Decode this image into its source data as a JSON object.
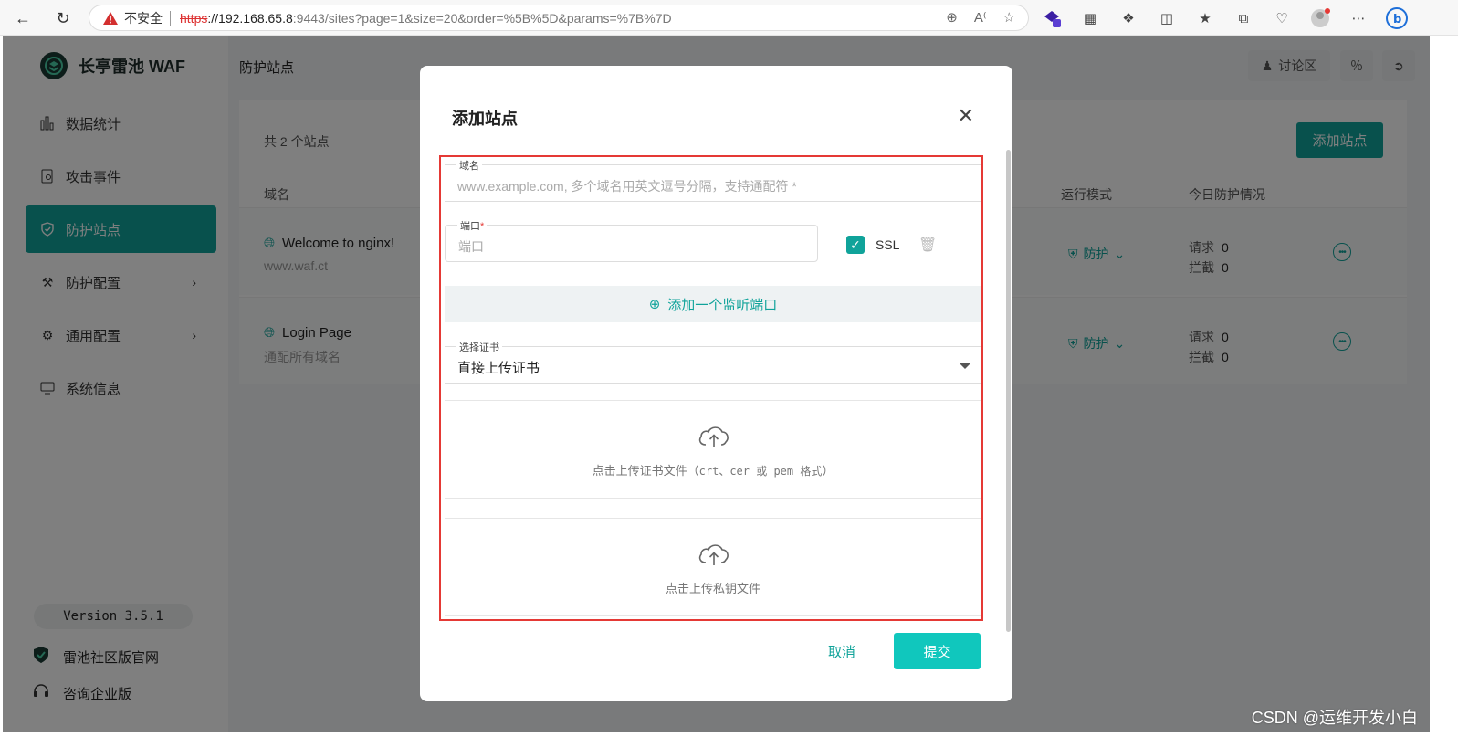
{
  "browser": {
    "insecure_label": "不安全",
    "url_scheme": "https",
    "url_host": "://192.168.65.8",
    "url_path": ":9443/sites?page=1&size=20&order=%5B%5D&params=%7B%7D"
  },
  "app": {
    "logo_text": "长亭雷池 WAF",
    "sidebar": {
      "items": [
        {
          "label": "数据统计",
          "icon": "bar-chart-icon"
        },
        {
          "label": "攻击事件",
          "icon": "document-search-icon"
        },
        {
          "label": "防护站点",
          "icon": "shield-icon",
          "active": true
        },
        {
          "label": "防护配置",
          "icon": "tools-icon",
          "has_arrow": true
        },
        {
          "label": "通用配置",
          "icon": "gear-icon",
          "has_arrow": true
        },
        {
          "label": "系统信息",
          "icon": "monitor-icon"
        }
      ],
      "version": "Version 3.5.1",
      "community_link": "雷池社区版官网",
      "enterprise_link": "咨询企业版"
    },
    "header": {
      "breadcrumb": "防护站点",
      "forum_label": "讨论区"
    },
    "sites_panel": {
      "count_text": "共 2 个站点",
      "add_button": "添加站点",
      "columns": {
        "domain": "域名",
        "mode": "运行模式",
        "today": "今日防护情况"
      },
      "rows": [
        {
          "name": "Welcome to nginx!",
          "domain": "www.waf.ct",
          "mode": "防护",
          "requests_label": "请求",
          "requests": "0",
          "blocked_label": "拦截",
          "blocked": "0"
        },
        {
          "name": "Login Page",
          "domain": "通配所有域名",
          "mode": "防护",
          "requests_label": "请求",
          "requests": "0",
          "blocked_label": "拦截",
          "blocked": "0"
        }
      ]
    }
  },
  "modal": {
    "title": "添加站点",
    "domain_label": "域名",
    "domain_placeholder": "www.example.com, 多个域名用英文逗号分隔，支持通配符 *",
    "port_label": "端口",
    "port_required": "*",
    "port_placeholder": "端口",
    "ssl_label": "SSL",
    "ssl_checked": true,
    "add_port_label": "添加一个监听端口",
    "cert_label": "选择证书",
    "cert_value": "直接上传证书",
    "upload_cert_prefix": "点击上传证书文件（",
    "upload_cert_formats": "crt、cer 或 pem 格式",
    "upload_cert_suffix": "）",
    "upload_key_text": "点击上传私钥文件",
    "cancel_label": "取消",
    "submit_label": "提交",
    "highlight_color": "#e53935",
    "accent_color": "#10a39a"
  },
  "watermark": "CSDN @运维开发小白"
}
